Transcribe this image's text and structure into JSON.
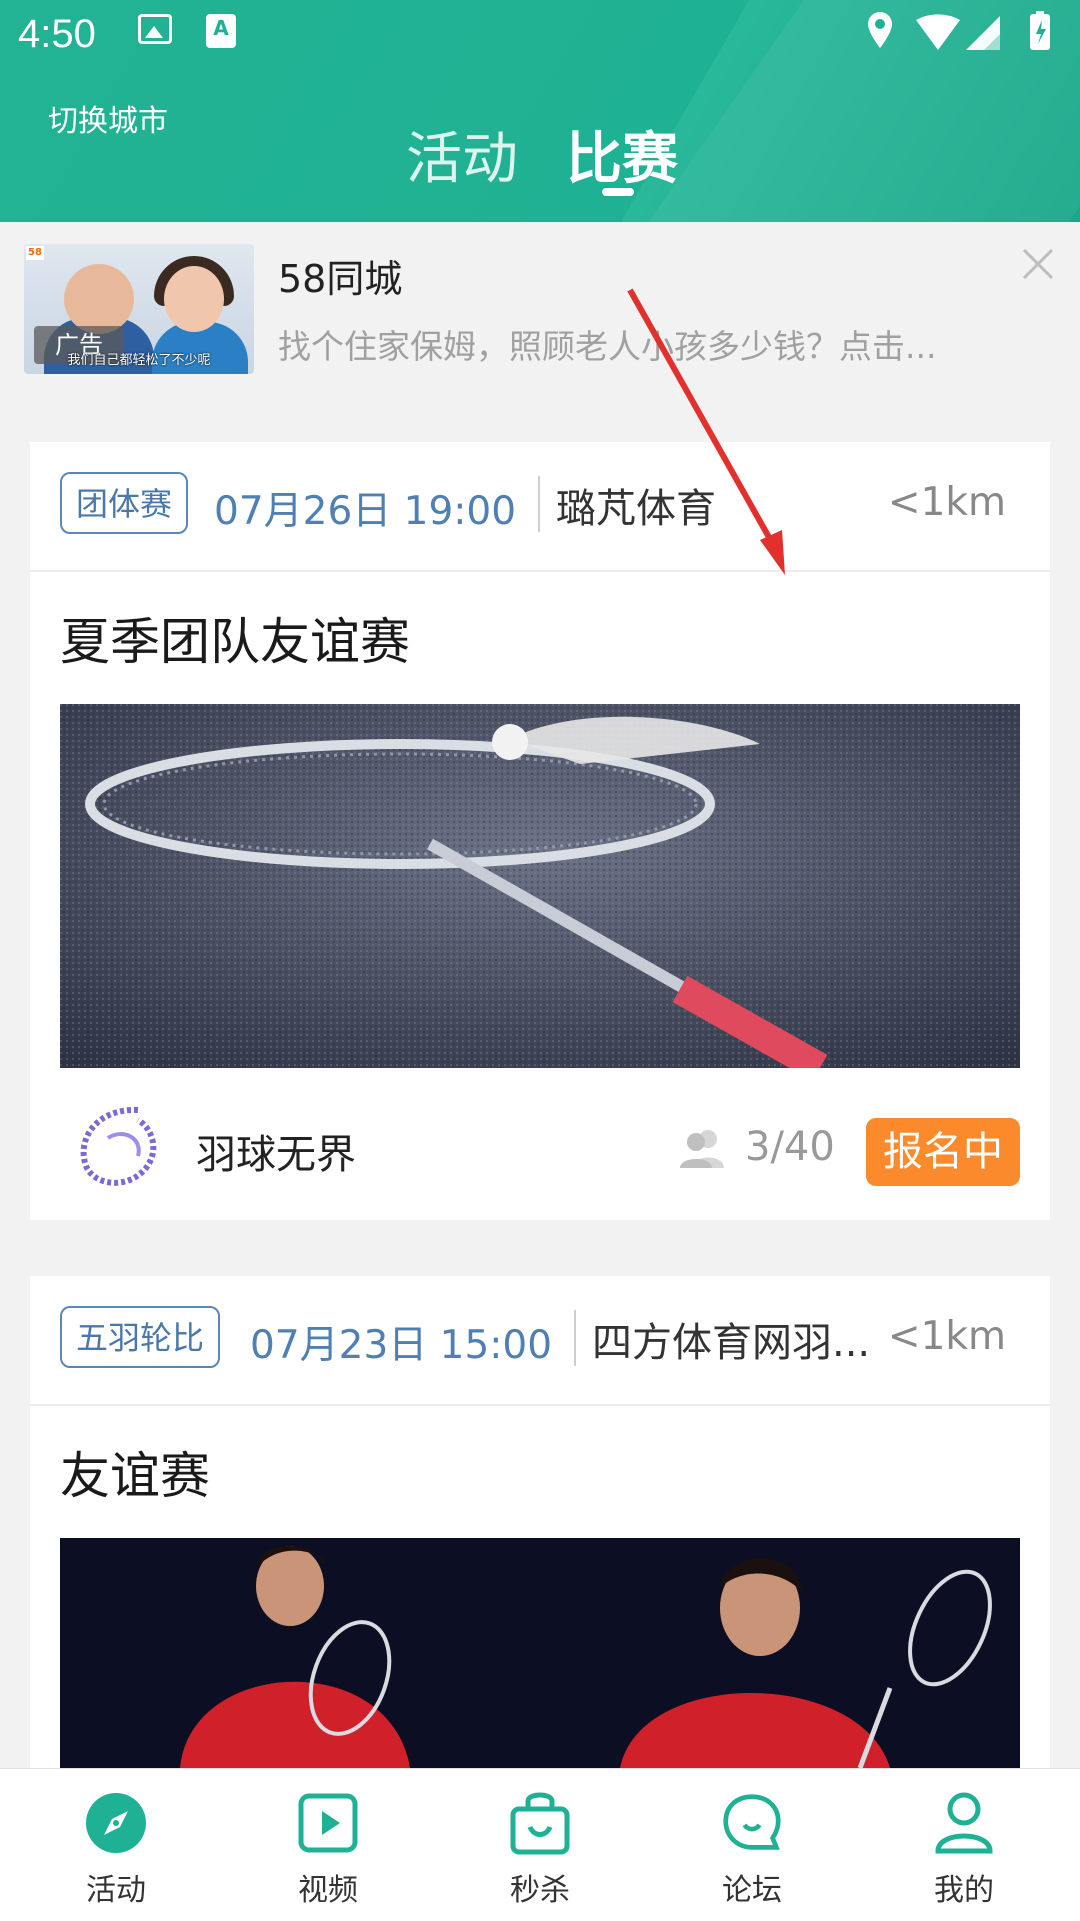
{
  "status_bar": {
    "time": "4:50"
  },
  "header": {
    "switch_city": "切换城市",
    "tabs": [
      {
        "label": "活动",
        "selected": false
      },
      {
        "label": "比赛",
        "selected": true
      }
    ]
  },
  "ad": {
    "source": "58同城",
    "description": "找个住家保姆，照顾老人小孩多少钱？点击...",
    "thumb_tag": "广告",
    "thumb_caption": "我们自己都轻松了不少呢"
  },
  "matches": [
    {
      "type": "团体赛",
      "datetime": "07月26日 19:00",
      "venue": "璐芃体育",
      "distance": "<1km",
      "title": "夏季团队友谊赛",
      "organizer": "羽球无界",
      "participants": "3/40",
      "status": "报名中"
    },
    {
      "type": "五羽轮比",
      "datetime": "07月23日 15:00",
      "venue": "四方体育网羽...",
      "distance": "<1km",
      "title": "友谊赛"
    }
  ],
  "bottom_nav": [
    {
      "label": "活动",
      "icon": "compass-icon",
      "active": true
    },
    {
      "label": "视频",
      "icon": "video-play-icon",
      "active": false
    },
    {
      "label": "秒杀",
      "icon": "shopping-bag-icon",
      "active": false
    },
    {
      "label": "论坛",
      "icon": "chat-bubble-icon",
      "active": false
    },
    {
      "label": "我的",
      "icon": "user-icon",
      "active": false
    }
  ],
  "colors": {
    "brand": "#1fb193",
    "badge_blue": "#4a78ad",
    "status_orange": "#fa8a2b"
  }
}
